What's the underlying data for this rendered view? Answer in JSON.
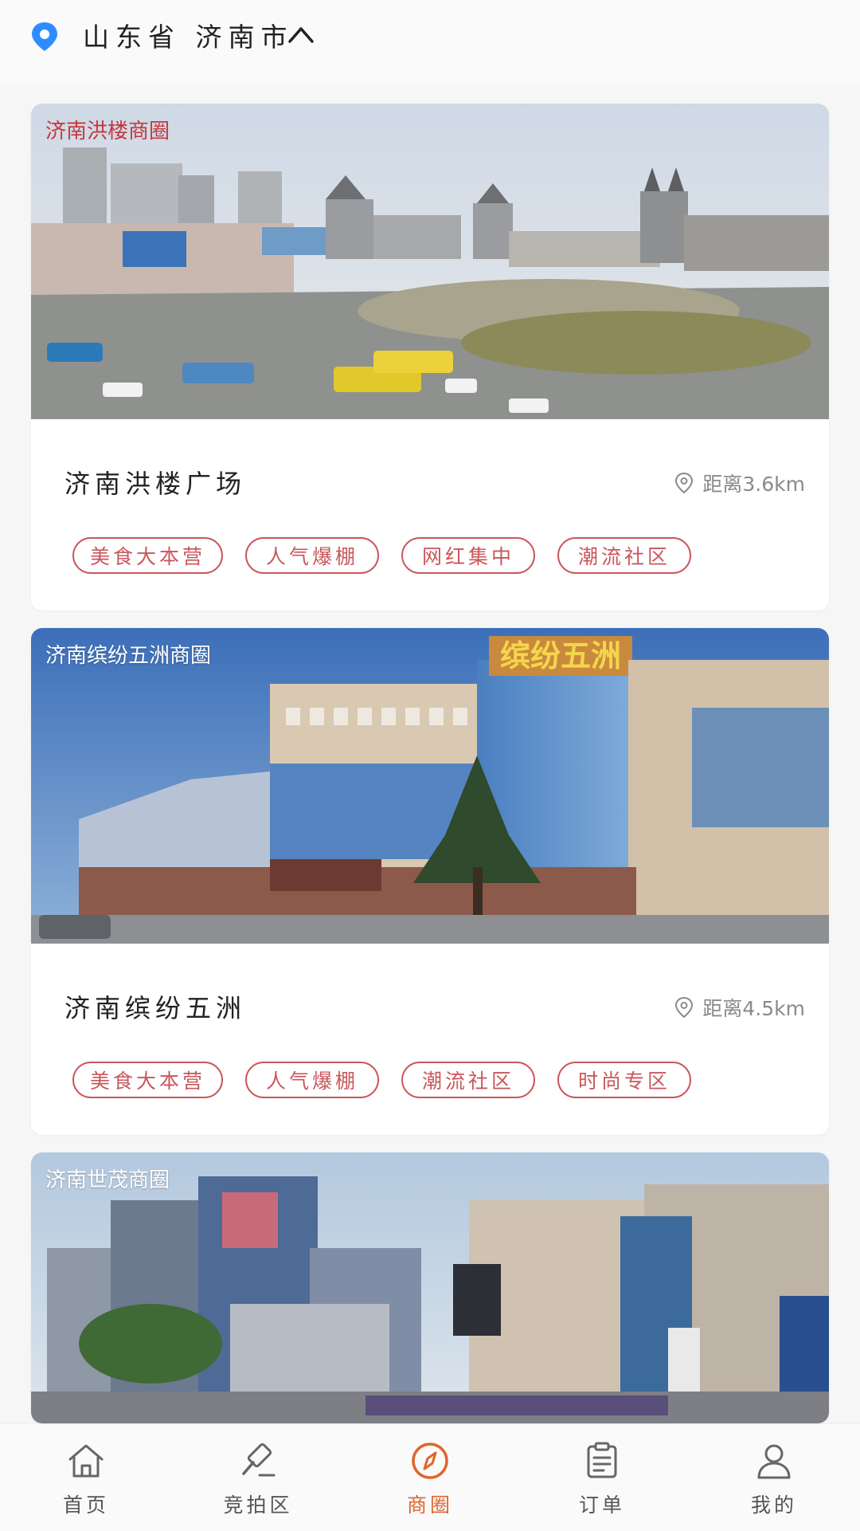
{
  "header": {
    "location": "山东省 济南市"
  },
  "cards": [
    {
      "photo_label": "济南洪楼商圈",
      "name": "济南洪楼广场",
      "distance": "距离3.6km",
      "tags": [
        "美食大本营",
        "人气爆棚",
        "网红集中",
        "潮流社区"
      ]
    },
    {
      "photo_label": "济南缤纷五洲商圈",
      "name": "济南缤纷五洲",
      "distance": "距离4.5km",
      "sign_text": "缤纷五洲",
      "tags": [
        "美食大本营",
        "人气爆棚",
        "潮流社区",
        "时尚专区"
      ]
    },
    {
      "photo_label": "济南世茂商圈"
    }
  ],
  "tabbar": {
    "items": [
      {
        "label": "首页",
        "icon": "home-icon"
      },
      {
        "label": "竞拍区",
        "icon": "gavel-icon"
      },
      {
        "label": "商圈",
        "icon": "compass-icon"
      },
      {
        "label": "订单",
        "icon": "clipboard-icon"
      },
      {
        "label": "我的",
        "icon": "user-icon"
      }
    ],
    "active_index": 2
  },
  "colors": {
    "accent": "#e0662b",
    "tag": "#c9575b",
    "location_pin": "#2f8cff"
  }
}
